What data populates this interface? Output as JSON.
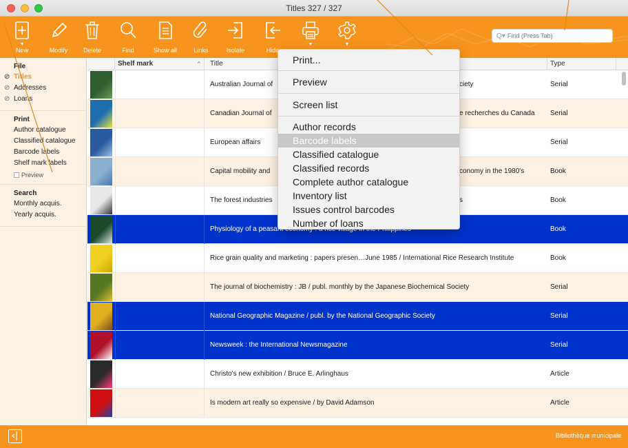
{
  "window": {
    "title": "Titles  327 / 327"
  },
  "toolbar": {
    "buttons": [
      {
        "label": "New",
        "icon": "new-icon"
      },
      {
        "label": "Modify",
        "icon": "pencil-icon"
      },
      {
        "label": "Delete",
        "icon": "trash-icon"
      },
      {
        "label": "Find",
        "icon": "magnifier-icon"
      },
      {
        "label": "Show all",
        "icon": "document-icon"
      },
      {
        "label": "Links",
        "icon": "paperclip-icon"
      },
      {
        "label": "Isolate",
        "icon": "isolate-icon"
      },
      {
        "label": "Hide",
        "icon": "hide-icon"
      },
      {
        "label": "",
        "icon": "printer-icon"
      },
      {
        "label": "",
        "icon": "gear-icon"
      }
    ],
    "search_placeholder": "Find (Press Tab)",
    "search_prefix": "Q▾"
  },
  "sidebar": {
    "file_heading": "File",
    "file_items": [
      {
        "label": "Titles",
        "active": true
      },
      {
        "label": "Addresses",
        "active": false
      },
      {
        "label": "Loans",
        "active": false
      }
    ],
    "print_heading": "Print",
    "print_items": [
      "Author catalogue",
      "Classified catalogue",
      "Barcode labels",
      "Shelf mark labels"
    ],
    "preview_label": "Preview",
    "search_heading": "Search",
    "search_items": [
      "Monthly acquis.",
      "Yearly acquis."
    ]
  },
  "table": {
    "columns": {
      "shelf": "Shelf mark",
      "title": "Title",
      "type": "Type"
    },
    "sort_indicator": "^",
    "rows": [
      {
        "title": "Australian Journal of",
        "title_end": "ciety",
        "type": "Serial",
        "selected": false
      },
      {
        "title": "Canadian Journal of",
        "title_end": "e recherches du Canada",
        "type": "Serial",
        "selected": false
      },
      {
        "title": "European affairs",
        "title_end": "",
        "type": "Serial",
        "selected": false
      },
      {
        "title": "Capital mobility and",
        "title_end": "conomy in the 1980's",
        "type": "Book",
        "selected": false
      },
      {
        "title": "The forest industries",
        "title_end": "s",
        "type": "Book",
        "selected": false
      },
      {
        "title": "Physiology of a peasant economy : a rice village in the Philippines",
        "title_end": "",
        "type": "Book",
        "selected": true
      },
      {
        "title": "Rice grain quality and marketing : papers presen…June 1985 / International Rice Research Institute",
        "title_end": "",
        "type": "Book",
        "selected": false
      },
      {
        "title": "The journal of biochemistry : JB / publ. monthly by the Japanese Biochemical Society",
        "title_end": "",
        "type": "Serial",
        "selected": false
      },
      {
        "title": "National Geographic Magazine / publ. by the National Geographic Society",
        "title_end": "",
        "type": "Serial",
        "selected": true
      },
      {
        "title": "Newsweek : the International Newsmagazine",
        "title_end": "",
        "type": "Serial",
        "selected": true
      },
      {
        "title": "Christo's new exhibition / Bruce E. Arlinghaus",
        "title_end": "",
        "type": "Article",
        "selected": false
      },
      {
        "title": "Is modern art really so expensive / by David Adamson",
        "title_end": "",
        "type": "Article",
        "selected": false
      }
    ]
  },
  "menu": {
    "items": [
      "Print...",
      "Preview",
      "Screen list",
      "Author records",
      "Barcode labels",
      "Classified catalogue",
      "Classified records",
      "Complete author catalogue",
      "Inventory list",
      "Issues control barcodes",
      "Number of loans"
    ],
    "highlighted": "Barcode labels"
  },
  "footer": {
    "text": "Bibliothèque municipale"
  },
  "colors": {
    "accent": "#f7941d",
    "selection": "#0033cc",
    "sidebar_bg": "#fdf1e4"
  }
}
